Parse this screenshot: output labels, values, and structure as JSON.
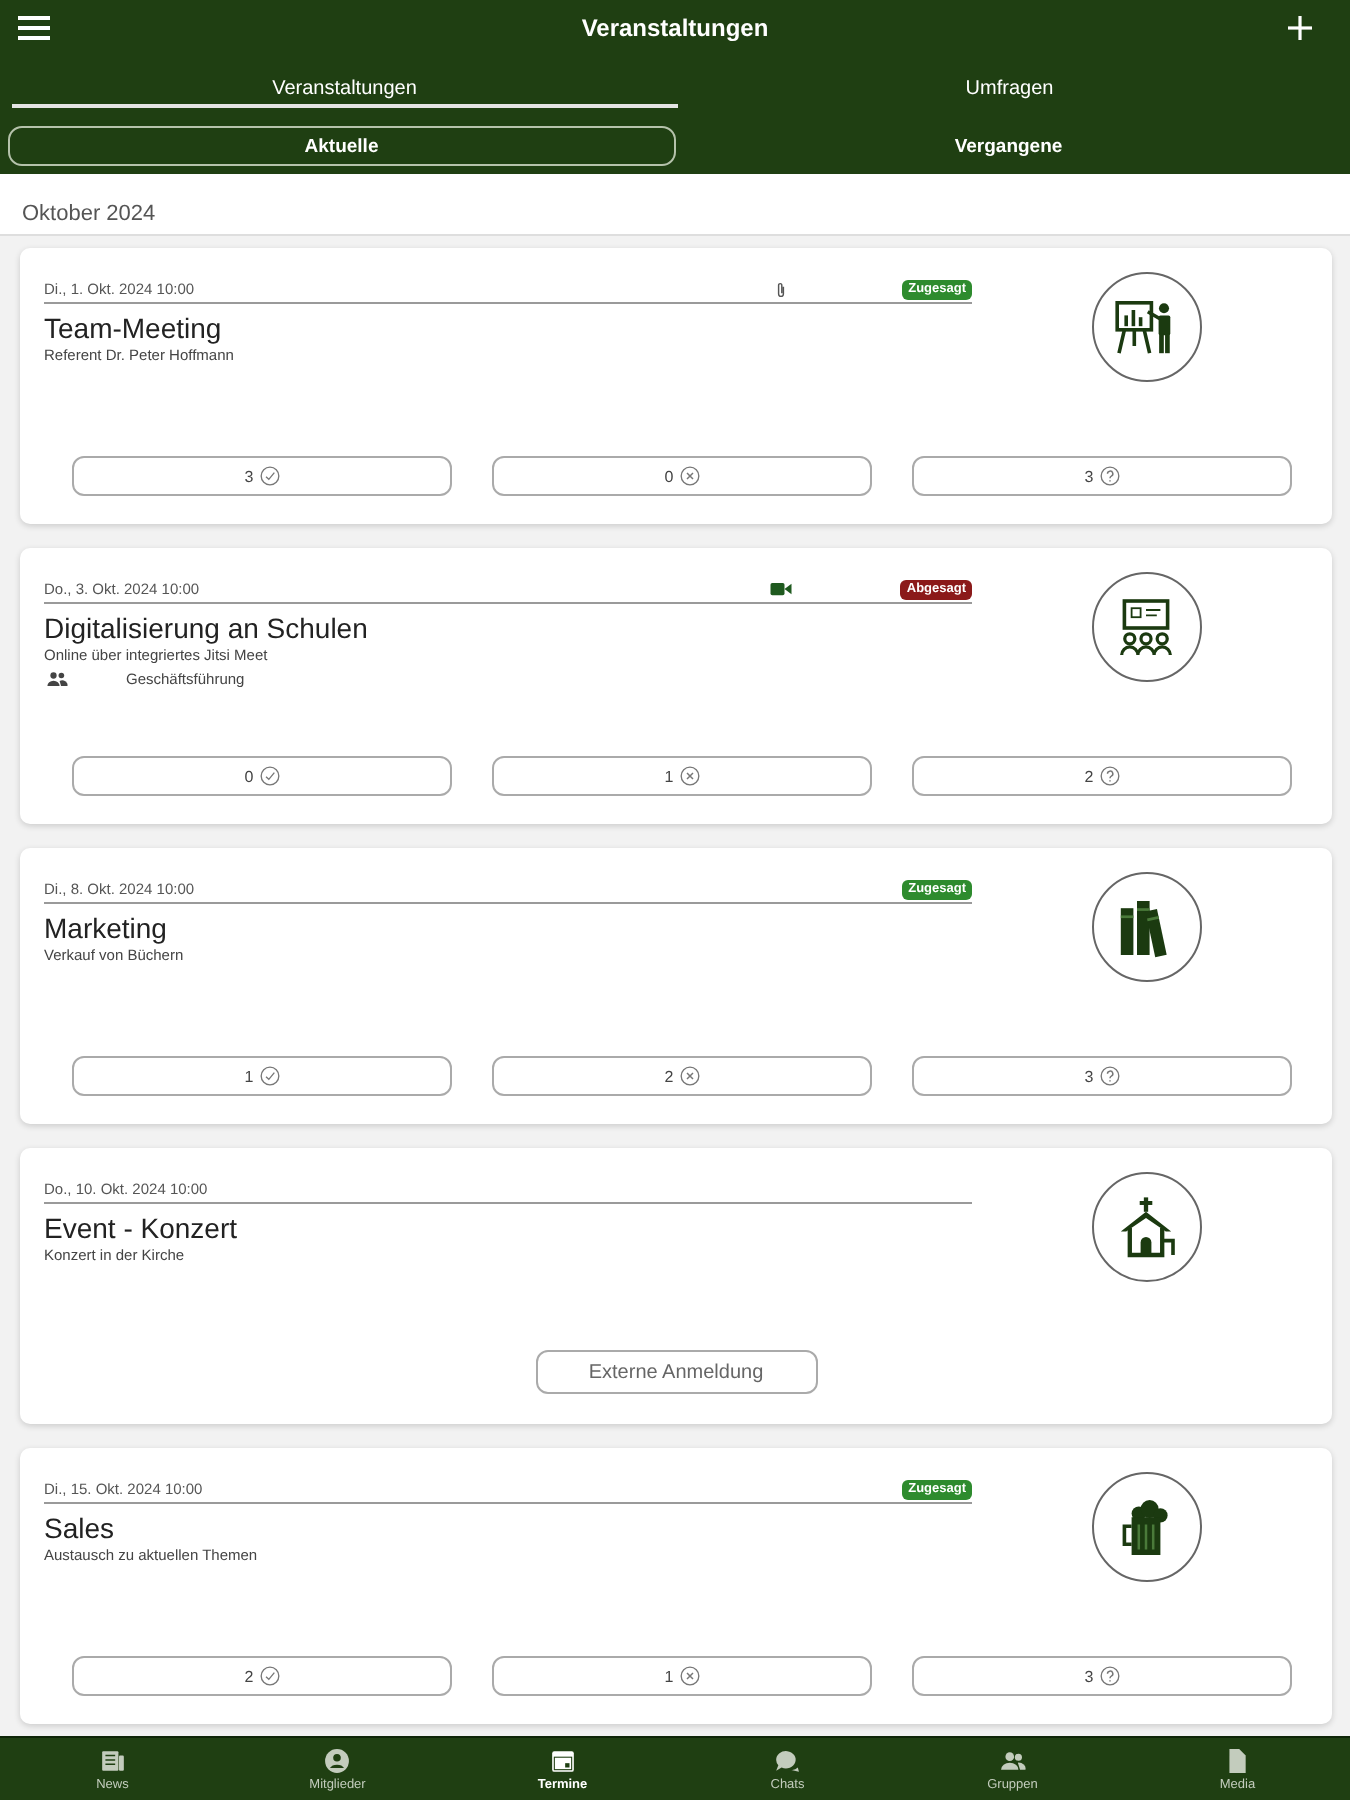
{
  "app_bar": {
    "title": "Veranstaltungen"
  },
  "tabs": [
    {
      "label": "Veranstaltungen",
      "selected": true
    },
    {
      "label": "Umfragen",
      "selected": false
    }
  ],
  "filters": [
    {
      "label": "Aktuelle",
      "selected": true
    },
    {
      "label": "Vergangene",
      "selected": false
    }
  ],
  "month": "Oktober 2024",
  "events": [
    {
      "kind": "rsvp",
      "date": "Di., 1. Okt. 2024 10:00",
      "attachment": true,
      "video": false,
      "badge": {
        "label": "Zugesagt",
        "color": "#2e8b2e"
      },
      "title": "Team-Meeting",
      "subtitle": "Referent Dr. Peter Hoffmann",
      "responses": [
        {
          "kind": "yes",
          "count": "3"
        },
        {
          "kind": "no",
          "count": "0"
        },
        {
          "kind": "maybe",
          "count": "3"
        }
      ]
    },
    {
      "kind": "rsvp",
      "date": "Do., 3. Okt. 2024 10:00",
      "attachment": false,
      "video": true,
      "badge": {
        "label": "Abgesagt",
        "color": "#8b1a1a"
      },
      "title": "Digitalisierung an Schulen",
      "subtitle": "Online über integriertes Jitsi Meet",
      "group": "Geschäftsführung",
      "responses": [
        {
          "kind": "yes",
          "count": "0"
        },
        {
          "kind": "no",
          "count": "1"
        },
        {
          "kind": "maybe",
          "count": "2"
        }
      ]
    },
    {
      "kind": "rsvp",
      "date": "Di., 8. Okt. 2024 10:00",
      "attachment": false,
      "video": false,
      "badge": {
        "label": "Zugesagt",
        "color": "#2e8b2e"
      },
      "title": "Marketing",
      "subtitle": "Verkauf von Büchern",
      "responses": [
        {
          "kind": "yes",
          "count": "1"
        },
        {
          "kind": "no",
          "count": "2"
        },
        {
          "kind": "maybe",
          "count": "3"
        }
      ]
    },
    {
      "kind": "external",
      "date": "Do., 10. Okt. 2024 10:00",
      "attachment": false,
      "video": false,
      "title": "Event - Konzert",
      "subtitle": "Konzert in der Kirche",
      "button": "Externe Anmeldung"
    },
    {
      "kind": "rsvp",
      "date": "Di., 15. Okt. 2024 10:00",
      "attachment": false,
      "video": false,
      "badge": {
        "label": "Zugesagt",
        "color": "#2e8b2e"
      },
      "title": "Sales",
      "subtitle": "Austausch zu aktuellen Themen",
      "responses": [
        {
          "kind": "yes",
          "count": "2"
        },
        {
          "kind": "no",
          "count": "1"
        },
        {
          "kind": "maybe",
          "count": "3"
        }
      ]
    }
  ],
  "bottom_nav": [
    {
      "label": "News",
      "selected": false
    },
    {
      "label": "Mitglieder",
      "selected": false
    },
    {
      "label": "Termine",
      "selected": true
    },
    {
      "label": "Chats",
      "selected": false
    },
    {
      "label": "Gruppen",
      "selected": false
    },
    {
      "label": "Media",
      "selected": false
    }
  ]
}
